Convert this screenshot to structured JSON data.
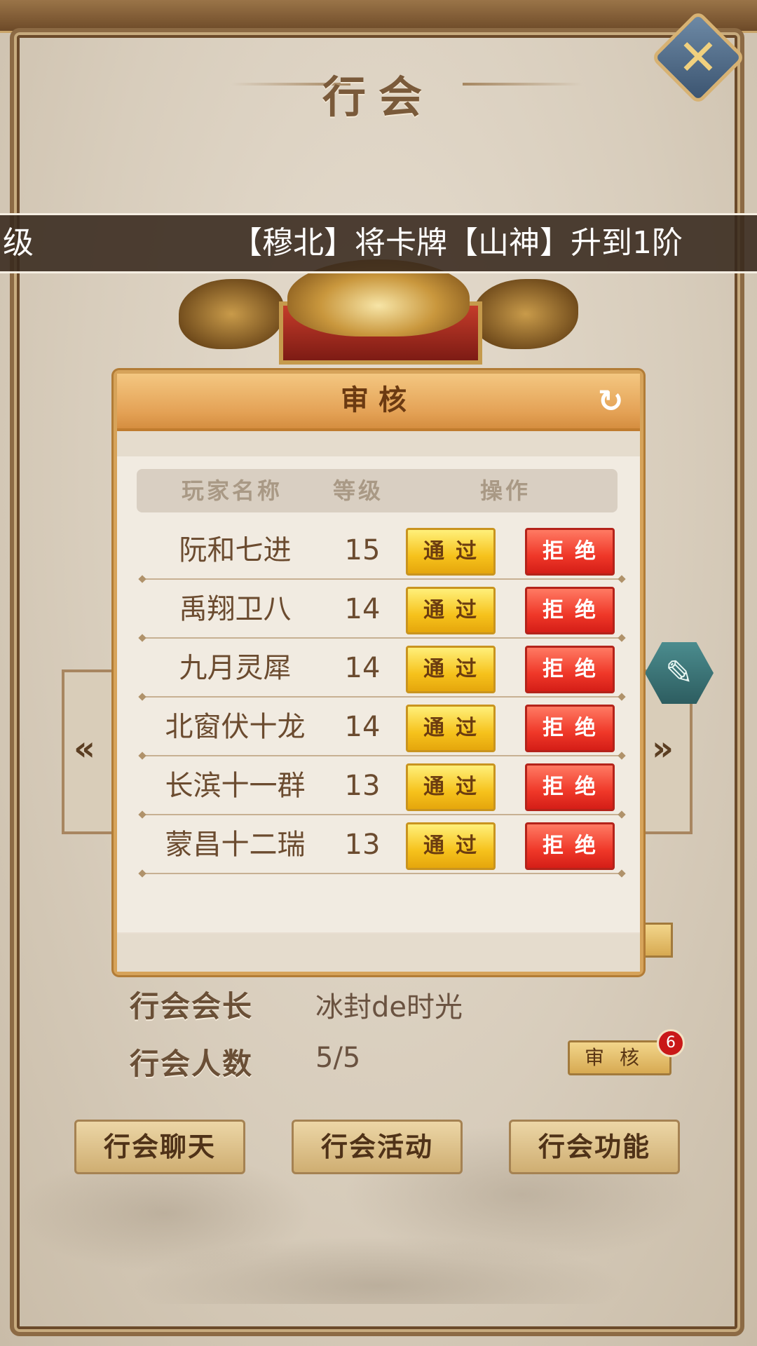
{
  "page": {
    "title": "行会",
    "marquee": {
      "left_text": "级",
      "right_text": "【穆北】将卡牌【山神】升到1阶"
    }
  },
  "info": {
    "leader_label": "行会会长",
    "leader_value": "冰封de时光",
    "members_label": "行会人数",
    "members_value": "5/5",
    "review_button": "审核",
    "review_badge": "6"
  },
  "bottom_buttons": [
    "行会聊天",
    "行会活动",
    "行会功能"
  ],
  "modal": {
    "title": "审核",
    "columns": [
      "玩家名称",
      "等级",
      "操作"
    ],
    "pass_label": "通过",
    "reject_label": "拒绝",
    "rows": [
      {
        "name": "阮和七进",
        "level": "15"
      },
      {
        "name": "禹翔卫八",
        "level": "14"
      },
      {
        "name": "九月灵犀",
        "level": "14"
      },
      {
        "name": "北窗伏十龙",
        "level": "14"
      },
      {
        "name": "长滨十一群",
        "level": "13"
      },
      {
        "name": "蒙昌十二瑞",
        "level": "13"
      }
    ]
  },
  "icons": {
    "close": "close-icon",
    "refresh": "refresh-icon",
    "brush": "brush-icon",
    "prev": "chevron-left-icon",
    "next": "chevron-right-icon"
  },
  "colors": {
    "modal_header": "#e4a256",
    "pass_button": "#f6c21c",
    "reject_button": "#ef3728",
    "badge": "#c91818"
  }
}
